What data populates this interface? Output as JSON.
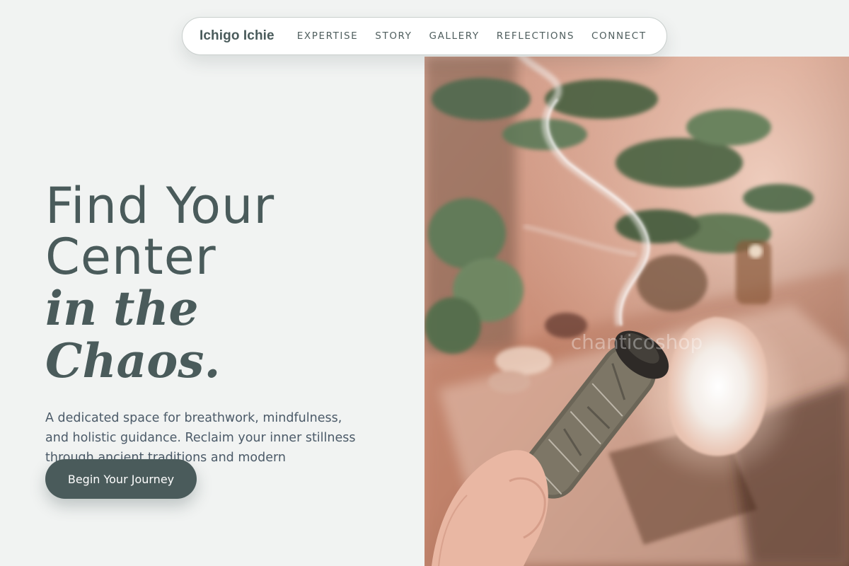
{
  "nav": {
    "brand": "Ichigo Ichie",
    "links": [
      "EXPERTISE",
      "STORY",
      "GALLERY",
      "REFLECTIONS",
      "CONNECT"
    ]
  },
  "hero": {
    "line1": "Find Your",
    "line2": "Center",
    "italic": "in the Chaos.",
    "description": "A dedicated space for breathwork, mindfulness, and holistic guidance. Reclaim your inner stillness through ancient traditions and modern awareness.",
    "cta_label": "Begin Your Journey"
  },
  "image": {
    "watermark": "chanticoshop"
  },
  "colors": {
    "background": "#f1f3f2",
    "text": "#4a5b5b",
    "body_text": "#4b5a68",
    "button": "#4a5b5b"
  }
}
